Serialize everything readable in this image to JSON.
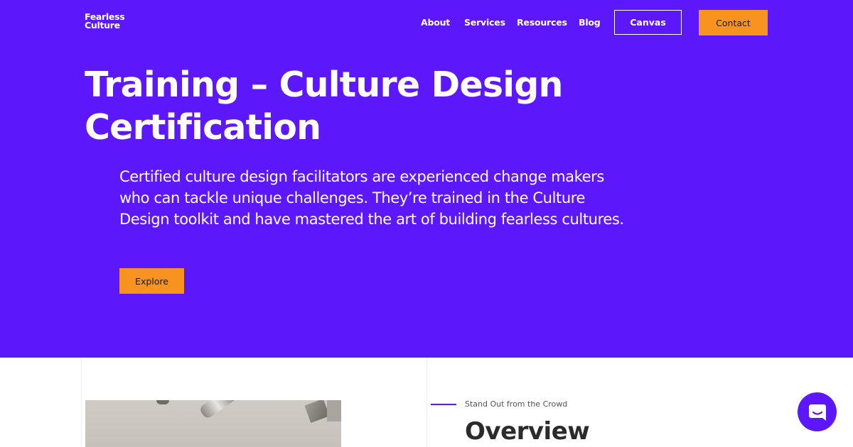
{
  "header": {
    "logo_line1": "Fearless",
    "logo_line2": "Culture",
    "nav": {
      "about": "About",
      "services": "Services",
      "resources": "Resources",
      "blog": "Blog"
    },
    "canvas_label": "Canvas",
    "contact_label": "Contact"
  },
  "hero": {
    "title": "Training – Culture Design Certification",
    "description": "Certified culture design facilitators are experienced change makers who can tackle unique challenges. They’re trained in the Culture Design toolkit and have mastered the art of building fearless cultures.",
    "explore_label": "Explore"
  },
  "overview": {
    "kicker": "Stand Out from the Crowd",
    "heading": "Overview"
  },
  "icons": {
    "chat": "chat-bubble-icon"
  },
  "colors": {
    "brand_purple": "#5c17fb",
    "accent_orange": "#f7931e"
  }
}
